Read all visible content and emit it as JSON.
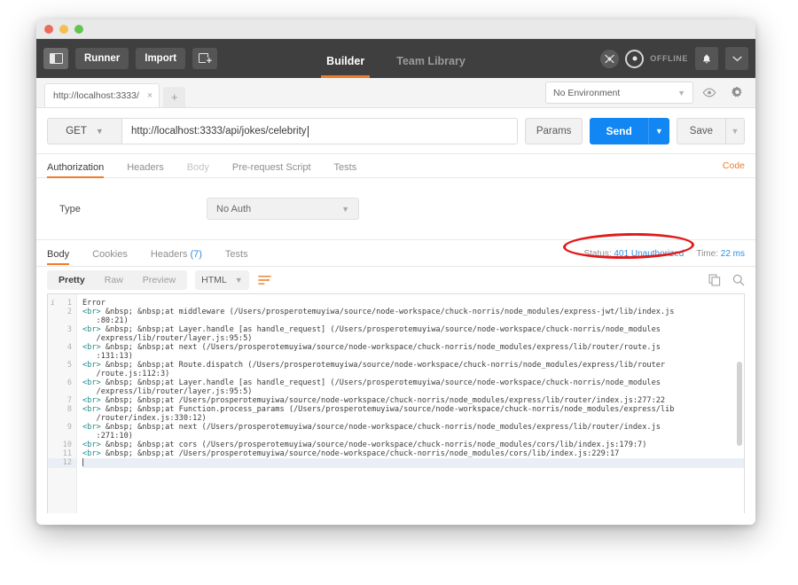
{
  "window": {
    "traffic_lights": [
      "close",
      "minimize",
      "zoom"
    ]
  },
  "appbar": {
    "sidebar_toggle": "sidebar-toggle",
    "runner_label": "Runner",
    "import_label": "Import",
    "new_tab_label": "new-window",
    "tabs": [
      {
        "label": "Builder",
        "active": true
      },
      {
        "label": "Team Library",
        "active": false
      }
    ],
    "sync_status": "OFFLINE",
    "notifications_icon": "bell-icon",
    "account_chevron": "chevron-down-icon"
  },
  "tabstrip": {
    "request_tab_label": "http://localhost:3333/",
    "close_label": "×",
    "add_label": "+",
    "environment_value": "No Environment",
    "eye_icon": "eye-icon",
    "settings_icon": "gear-icon"
  },
  "request": {
    "method": "GET",
    "url": "http://localhost:3333/api/jokes/celebrity",
    "params_label": "Params",
    "send_label": "Send",
    "save_label": "Save",
    "code_label": "Code",
    "tabs": [
      {
        "label": "Authorization",
        "state": "active"
      },
      {
        "label": "Headers",
        "state": "normal"
      },
      {
        "label": "Body",
        "state": "dim"
      },
      {
        "label": "Pre-request Script",
        "state": "normal"
      },
      {
        "label": "Tests",
        "state": "normal"
      }
    ],
    "auth_type_label": "Type",
    "auth_type_value": "No Auth"
  },
  "response": {
    "tabs": [
      {
        "label": "Body",
        "active": true
      },
      {
        "label": "Cookies",
        "active": false
      },
      {
        "label": "Headers",
        "active": false,
        "count": "(7)"
      },
      {
        "label": "Tests",
        "active": false
      }
    ],
    "status_label": "Status:",
    "status_value": "401 Unauthorized",
    "time_label": "Time:",
    "time_value": "22 ms",
    "annotation_color": "#e01b1b",
    "status_color": "#2f8fe0",
    "view_modes": [
      {
        "label": "Pretty",
        "active": true
      },
      {
        "label": "Raw",
        "active": false
      },
      {
        "label": "Preview",
        "active": false
      }
    ],
    "format": "HTML",
    "wrap_icon": "word-wrap-icon",
    "copy_icon": "copy-icon",
    "search_icon": "search-icon",
    "gutter_info": "i",
    "lines": [
      {
        "n": "1",
        "segments": [
          {
            "t": "text",
            "v": "Error"
          }
        ]
      },
      {
        "n": "2",
        "segments": [
          {
            "t": "tag",
            "v": "<br>"
          },
          {
            "t": "text",
            "v": " &nbsp; &nbsp;at middleware (/Users/prosperotemuyiwa/source/node-workspace/chuck-norris/node_modules/express-jwt/lib/index.js\n   :80:21)"
          }
        ]
      },
      {
        "n": "3",
        "segments": [
          {
            "t": "tag",
            "v": "<br>"
          },
          {
            "t": "text",
            "v": " &nbsp; &nbsp;at Layer.handle [as handle_request] (/Users/prosperotemuyiwa/source/node-workspace/chuck-norris/node_modules\n   /express/lib/router/layer.js:95:5)"
          }
        ]
      },
      {
        "n": "4",
        "segments": [
          {
            "t": "tag",
            "v": "<br>"
          },
          {
            "t": "text",
            "v": " &nbsp; &nbsp;at next (/Users/prosperotemuyiwa/source/node-workspace/chuck-norris/node_modules/express/lib/router/route.js\n   :131:13)"
          }
        ]
      },
      {
        "n": "5",
        "segments": [
          {
            "t": "tag",
            "v": "<br>"
          },
          {
            "t": "text",
            "v": " &nbsp; &nbsp;at Route.dispatch (/Users/prosperotemuyiwa/source/node-workspace/chuck-norris/node_modules/express/lib/router\n   /route.js:112:3)"
          }
        ]
      },
      {
        "n": "6",
        "segments": [
          {
            "t": "tag",
            "v": "<br>"
          },
          {
            "t": "text",
            "v": " &nbsp; &nbsp;at Layer.handle [as handle_request] (/Users/prosperotemuyiwa/source/node-workspace/chuck-norris/node_modules\n   /express/lib/router/layer.js:95:5)"
          }
        ]
      },
      {
        "n": "7",
        "segments": [
          {
            "t": "tag",
            "v": "<br>"
          },
          {
            "t": "text",
            "v": " &nbsp; &nbsp;at /Users/prosperotemuyiwa/source/node-workspace/chuck-norris/node_modules/express/lib/router/index.js:277:22"
          }
        ]
      },
      {
        "n": "8",
        "segments": [
          {
            "t": "tag",
            "v": "<br>"
          },
          {
            "t": "text",
            "v": " &nbsp; &nbsp;at Function.process_params (/Users/prosperotemuyiwa/source/node-workspace/chuck-norris/node_modules/express/lib\n   /router/index.js:330:12)"
          }
        ]
      },
      {
        "n": "9",
        "segments": [
          {
            "t": "tag",
            "v": "<br>"
          },
          {
            "t": "text",
            "v": " &nbsp; &nbsp;at next (/Users/prosperotemuyiwa/source/node-workspace/chuck-norris/node_modules/express/lib/router/index.js\n   :271:10)"
          }
        ]
      },
      {
        "n": "10",
        "segments": [
          {
            "t": "tag",
            "v": "<br>"
          },
          {
            "t": "text",
            "v": " &nbsp; &nbsp;at cors (/Users/prosperotemuyiwa/source/node-workspace/chuck-norris/node_modules/cors/lib/index.js:179:7)"
          }
        ]
      },
      {
        "n": "11",
        "segments": [
          {
            "t": "tag",
            "v": "<br>"
          },
          {
            "t": "text",
            "v": " &nbsp; &nbsp;at /Users/prosperotemuyiwa/source/node-workspace/chuck-norris/node_modules/cors/lib/index.js:229:17"
          }
        ]
      },
      {
        "n": "12",
        "segments": []
      }
    ]
  }
}
